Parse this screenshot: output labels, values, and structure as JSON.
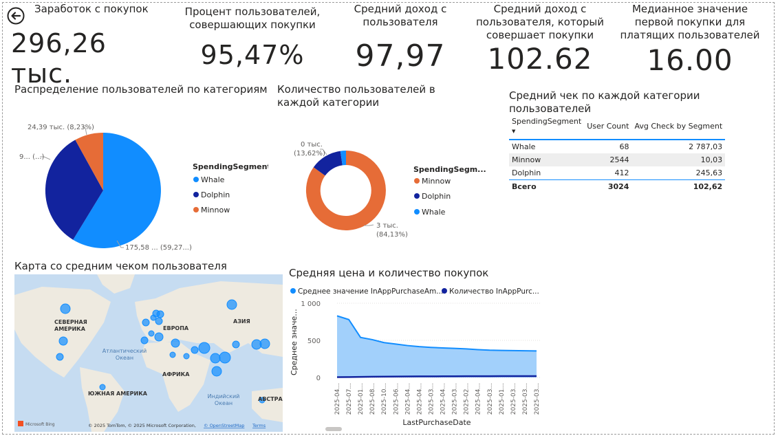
{
  "kpis": [
    {
      "label": "Заработок с покупок",
      "value": "296,26 тыс."
    },
    {
      "label": "Процент пользователей, совершающих покупки",
      "value": "95,47%"
    },
    {
      "label": "Средний доход с пользователя",
      "value": "97,97"
    },
    {
      "label": "Средний доход с пользователя, который совершает покупки",
      "value": "102.62"
    },
    {
      "label": "Медианное значение первой покупки для платящих пользователей",
      "value": "16.00"
    }
  ],
  "pie": {
    "title": "Распределение пользователей по категориям",
    "legend_title": "SpendingSegment",
    "legend": [
      "Whale",
      "Dolphin",
      "Minnow"
    ],
    "labels": [
      "24,39 тыс. (8,23%)",
      "9... (...)",
      "175,58 ... (59,27...)"
    ]
  },
  "donut": {
    "title": "Количество пользователей в каждой категории",
    "legend_title": "SpendingSegm...",
    "legend": [
      "Minnow",
      "Dolphin",
      "Whale"
    ],
    "labels": [
      "0 тыс.",
      "(13,62%)",
      "3 тыс.",
      "(84,13%)"
    ]
  },
  "table": {
    "title": "Средний чек по каждой категории пользователей",
    "headers": [
      "SpendingSegment",
      "User Count",
      "Avg Check by Segment"
    ],
    "rows": [
      [
        "Whale",
        "68",
        "2 787,03"
      ],
      [
        "Minnow",
        "2544",
        "10,03"
      ],
      [
        "Dolphin",
        "412",
        "245,63"
      ]
    ],
    "total": [
      "Всего",
      "3024",
      "102,62"
    ]
  },
  "map": {
    "title": "Карта со средним чеком пользователя",
    "labels": {
      "na": "СЕВЕРНАЯ",
      "na2": "АМЕРИКА",
      "eu": "ЕВРОПА",
      "asia": "АЗИЯ",
      "atl": "Атлантический",
      "atl2": "Океан",
      "africa": "АФРИКА",
      "sa": "ЮЖНАЯ АМЕРИКА",
      "ind": "Индийский",
      "ind2": "Океан",
      "aus": "АВСТРА"
    },
    "bing": "Microsoft Bing",
    "copyright": "© 2025 TomTom, © 2025 Microsoft Corporation,",
    "osm": "© OpenStreetMap",
    "terms": "Terms"
  },
  "colors": {
    "whale": "#118dff",
    "dolphin": "#12239e",
    "minnow": "#e66c37",
    "area": "#a2d0fb"
  },
  "chart_data": [
    {
      "type": "pie",
      "title": "Распределение пользователей по категориям",
      "categories": [
        "Whale",
        "Dolphin",
        "Minnow"
      ],
      "values": [
        59.27,
        32.5,
        8.23
      ],
      "unit": "%"
    },
    {
      "type": "pie",
      "title": "Количество пользователей в каждой категории",
      "categories": [
        "Minnow",
        "Dolphin",
        "Whale"
      ],
      "values": [
        84.13,
        13.62,
        2.25
      ],
      "unit": "%",
      "donut": true
    },
    {
      "type": "area",
      "title": "Средняя цена и количество покупок",
      "xlabel": "LastPurchaseDate",
      "ylabel": "Среднее значе...",
      "x": [
        "2025-04...",
        "2025-07...",
        "2025-01...",
        "2025-08...",
        "2025-10...",
        "2025-06...",
        "2025-04...",
        "2025-04...",
        "2025-03...",
        "2025-04...",
        "2025-03...",
        "2025-02...",
        "2025-04...",
        "2025-03...",
        "2025-01...",
        "2025-03...",
        "2025-03...",
        "2025-03..."
      ],
      "ylim": [
        0,
        1000
      ],
      "yticks": [
        "0",
        "500",
        "1 000"
      ],
      "series": [
        {
          "name": "Среднее значение InAppPurchaseAm...",
          "values": [
            830,
            780,
            540,
            510,
            470,
            450,
            430,
            415,
            405,
            398,
            392,
            385,
            375,
            368,
            365,
            362,
            360,
            358
          ]
        },
        {
          "name": "Количество InAppPurc...",
          "values": [
            5,
            6,
            8,
            10,
            12,
            13,
            14,
            15,
            15,
            16,
            16,
            17,
            17,
            17,
            18,
            18,
            18,
            18
          ]
        }
      ]
    }
  ]
}
